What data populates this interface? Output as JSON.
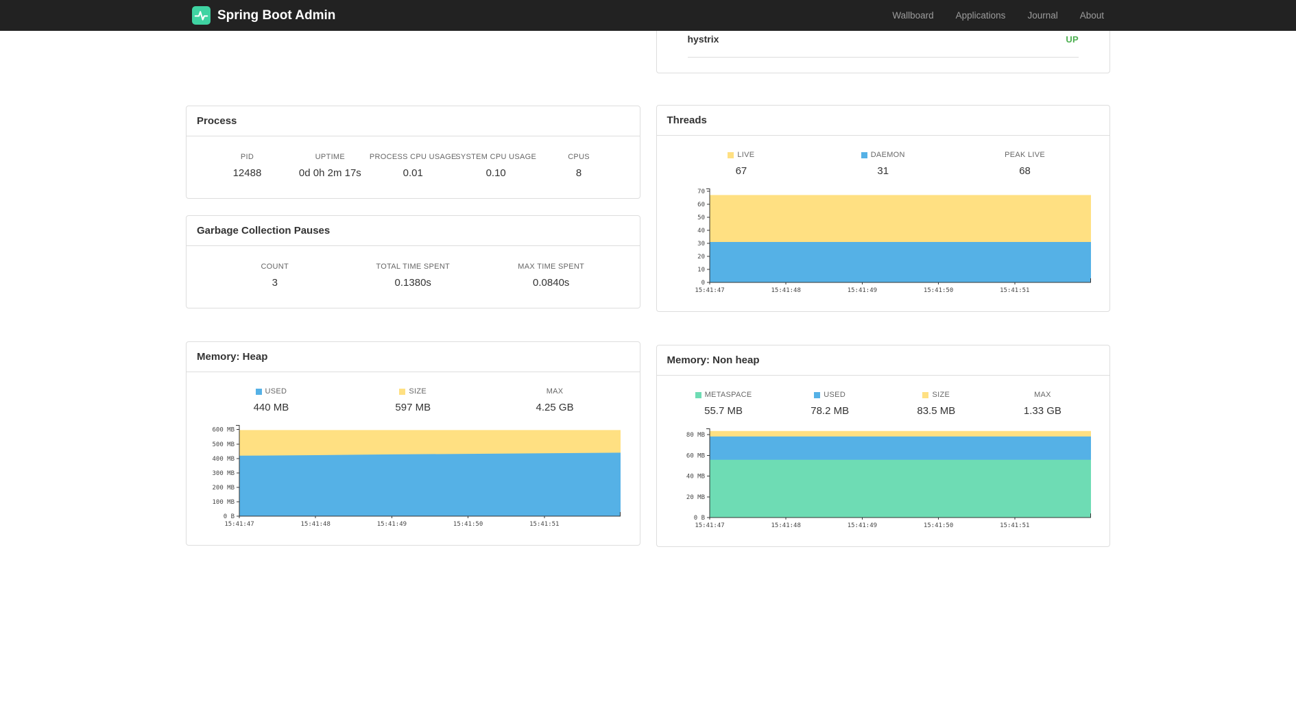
{
  "navbar": {
    "brand": "Spring Boot Admin",
    "items": [
      {
        "label": "Wallboard"
      },
      {
        "label": "Applications"
      },
      {
        "label": "Journal"
      },
      {
        "label": "About"
      }
    ]
  },
  "colors": {
    "accent_green": "#3fd3a2",
    "status_up": "#4CAF50",
    "series_yellow": "#FFE082",
    "series_blue": "#55B1E6",
    "series_green": "#6EDCB4",
    "navbar_bg": "#222222"
  },
  "hystrix_panel": {
    "row_label": "hystrix",
    "status": "UP",
    "status_color": "#4CAF50"
  },
  "process_panel": {
    "title": "Process",
    "stats": [
      {
        "label": "PID",
        "value": "12488"
      },
      {
        "label": "UPTIME",
        "value": "0d 0h 2m 17s"
      },
      {
        "label": "PROCESS CPU USAGE",
        "value": "0.01"
      },
      {
        "label": "SYSTEM CPU USAGE",
        "value": "0.10"
      },
      {
        "label": "CPUS",
        "value": "8"
      }
    ]
  },
  "gc_panel": {
    "title": "Garbage Collection Pauses",
    "stats": [
      {
        "label": "COUNT",
        "value": "3"
      },
      {
        "label": "TOTAL TIME SPENT",
        "value": "0.1380s"
      },
      {
        "label": "MAX TIME SPENT",
        "value": "0.0840s"
      }
    ]
  },
  "threads_panel": {
    "title": "Threads",
    "stats": [
      {
        "label": "LIVE",
        "value": "67",
        "color": "#FFE082"
      },
      {
        "label": "DAEMON",
        "value": "31",
        "color": "#55B1E6"
      },
      {
        "label": "PEAK LIVE",
        "value": "68"
      }
    ]
  },
  "heap_panel": {
    "title": "Memory: Heap",
    "stats": [
      {
        "label": "USED",
        "value": "440 MB",
        "color": "#55B1E6"
      },
      {
        "label": "SIZE",
        "value": "597 MB",
        "color": "#FFE082"
      },
      {
        "label": "MAX",
        "value": "4.25 GB"
      }
    ]
  },
  "nonheap_panel": {
    "title": "Memory: Non heap",
    "stats": [
      {
        "label": "METASPACE",
        "value": "55.7 MB",
        "color": "#6EDCB4"
      },
      {
        "label": "USED",
        "value": "78.2 MB",
        "color": "#55B1E6"
      },
      {
        "label": "SIZE",
        "value": "83.5 MB",
        "color": "#FFE082"
      },
      {
        "label": "MAX",
        "value": "1.33 GB"
      }
    ]
  },
  "chart_data": [
    {
      "id": "threads",
      "type": "area",
      "title": "Threads",
      "stacked": true,
      "grid": false,
      "legend_position": "top",
      "x_labels": [
        "15:41:47",
        "15:41:48",
        "15:41:49",
        "15:41:50",
        "15:41:51"
      ],
      "points": 6,
      "ylim": [
        0,
        72
      ],
      "yticks": [
        {
          "value": 0,
          "label": "0"
        },
        {
          "value": 10,
          "label": "10"
        },
        {
          "value": 20,
          "label": "20"
        },
        {
          "value": 30,
          "label": "30"
        },
        {
          "value": 40,
          "label": "40"
        },
        {
          "value": 50,
          "label": "50"
        },
        {
          "value": 60,
          "label": "60"
        },
        {
          "value": 70,
          "label": "70"
        }
      ],
      "series": [
        {
          "name": "LIVE",
          "color": "#FFE082",
          "tops": [
            67,
            67,
            67,
            67,
            67,
            67
          ]
        },
        {
          "name": "DAEMON",
          "color": "#55B1E6",
          "tops": [
            31,
            31,
            31,
            31,
            31,
            31
          ]
        }
      ]
    },
    {
      "id": "heap",
      "type": "area",
      "title": "Memory: Heap",
      "stacked": true,
      "grid": false,
      "legend_position": "top",
      "x_labels": [
        "15:41:47",
        "15:41:48",
        "15:41:49",
        "15:41:50",
        "15:41:51"
      ],
      "points": 6,
      "ylim": [
        0,
        632
      ],
      "yticks": [
        {
          "value": 0,
          "label": "0 B"
        },
        {
          "value": 100,
          "label": "100 MB"
        },
        {
          "value": 200,
          "label": "200 MB"
        },
        {
          "value": 300,
          "label": "300 MB"
        },
        {
          "value": 400,
          "label": "400 MB"
        },
        {
          "value": 500,
          "label": "500 MB"
        },
        {
          "value": 600,
          "label": "600 MB"
        }
      ],
      "series": [
        {
          "name": "SIZE",
          "color": "#FFE082",
          "tops": [
            597,
            597,
            597,
            597,
            597,
            597
          ]
        },
        {
          "name": "USED",
          "color": "#55B1E6",
          "tops": [
            419,
            423,
            428,
            432,
            436,
            440
          ]
        }
      ]
    },
    {
      "id": "nonheap",
      "type": "area",
      "title": "Memory: Non heap",
      "stacked": true,
      "grid": false,
      "legend_position": "top",
      "x_labels": [
        "15:41:47",
        "15:41:48",
        "15:41:49",
        "15:41:50",
        "15:41:51"
      ],
      "points": 6,
      "ylim": [
        0,
        86
      ],
      "yticks": [
        {
          "value": 0,
          "label": "0 B"
        },
        {
          "value": 20,
          "label": "20 MB"
        },
        {
          "value": 40,
          "label": "40 MB"
        },
        {
          "value": 60,
          "label": "60 MB"
        },
        {
          "value": 80,
          "label": "80 MB"
        }
      ],
      "series": [
        {
          "name": "SIZE",
          "color": "#FFE082",
          "tops": [
            83.5,
            83.5,
            83.5,
            83.5,
            83.5,
            83.5
          ]
        },
        {
          "name": "USED",
          "color": "#55B1E6",
          "tops": [
            78.2,
            78.2,
            78.2,
            78.2,
            78.2,
            78.2
          ]
        },
        {
          "name": "METASPACE",
          "color": "#6EDCB4",
          "tops": [
            55.7,
            55.7,
            55.7,
            55.7,
            55.7,
            55.7
          ]
        }
      ]
    }
  ]
}
